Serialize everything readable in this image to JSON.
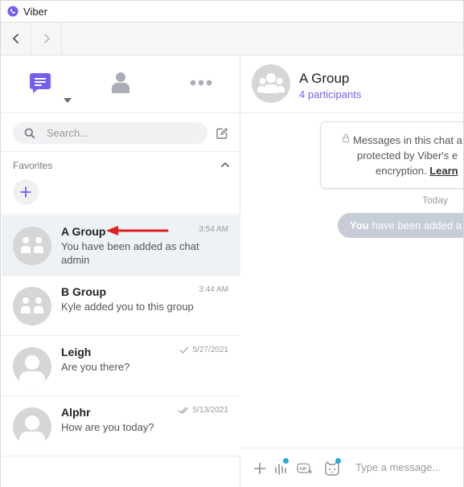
{
  "window": {
    "title": "Viber"
  },
  "nav": {
    "back_icon": "chevron-left-icon",
    "forward_icon": "chevron-right-icon"
  },
  "tabs": [
    {
      "name": "chats",
      "icon": "chat-bubble-icon",
      "active": true
    },
    {
      "name": "contacts",
      "icon": "person-icon",
      "active": false
    },
    {
      "name": "more",
      "icon": "more-dots-icon",
      "active": false
    }
  ],
  "search": {
    "placeholder": "Search..."
  },
  "favorites": {
    "label": "Favorites"
  },
  "chats": [
    {
      "name": "A Group",
      "preview": "You have been added as chat admin",
      "time": "3:54 AM",
      "avatar": "group-avatar",
      "selected": true,
      "read_receipt": ""
    },
    {
      "name": "B Group",
      "preview": "Kyle added you to this group",
      "time": "3:44 AM",
      "avatar": "group-avatar",
      "selected": false,
      "read_receipt": ""
    },
    {
      "name": "Leigh",
      "preview": "Are you there?",
      "time": "5/27/2021",
      "avatar": "person-avatar",
      "selected": false,
      "read_receipt": "single-check"
    },
    {
      "name": "Alphr",
      "preview": "How are you today?",
      "time": "5/13/2021",
      "avatar": "person-avatar",
      "selected": false,
      "read_receipt": "double-check"
    }
  ],
  "conversation": {
    "title": "A Group",
    "subtitle": "4 participants",
    "notice_line1": "Messages in this chat a",
    "notice_line2": "protected by Viber's e",
    "notice_line3": "encryption.",
    "notice_link": "Learn",
    "date_separator": "Today",
    "system_message_bold": "You",
    "system_message_rest": "have been added a"
  },
  "composer": {
    "placeholder": "Type a message..."
  },
  "colors": {
    "accent": "#7360f2",
    "selected_row": "#edf2f4",
    "annotation_arrow": "#e02020",
    "badge_dot": "#2aa8e0"
  }
}
